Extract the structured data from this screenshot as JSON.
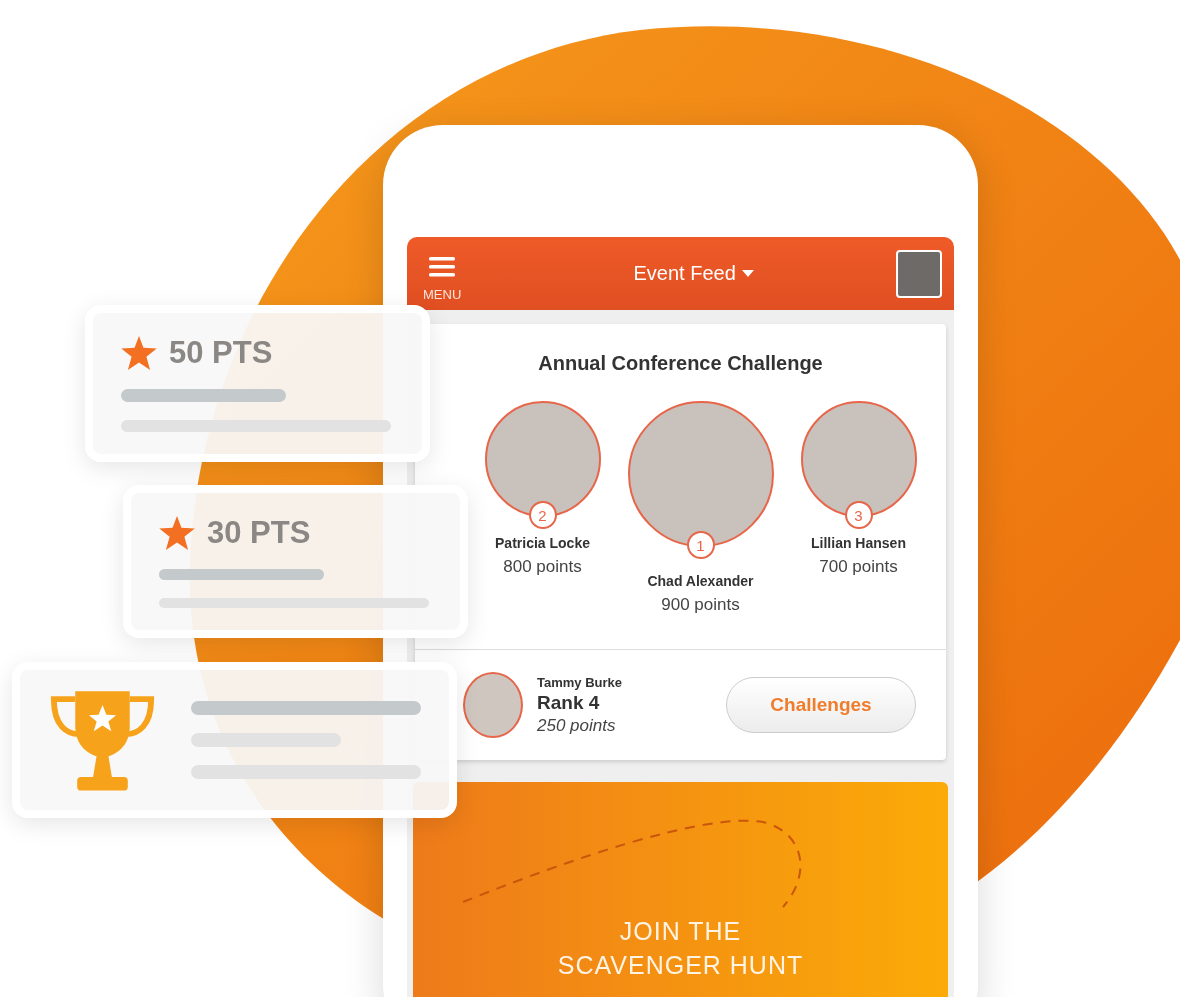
{
  "header": {
    "menu_label": "MENU",
    "title": "Event Feed"
  },
  "leaderboard": {
    "title": "Annual Conference Challenge",
    "leaders": [
      {
        "rank": "2",
        "name": "Patricia Locke",
        "points": "800 points"
      },
      {
        "rank": "1",
        "name": "Chad Alexander",
        "points": "900 points"
      },
      {
        "rank": "3",
        "name": "Lillian Hansen",
        "points": "700 points"
      }
    ]
  },
  "current_user": {
    "name": "Tammy Burke",
    "rank": "Rank 4",
    "points": "250 points"
  },
  "challenges_button": "Challenges",
  "banner": {
    "lines": [
      "JOIN THE",
      "SCAVENGER HUNT"
    ]
  },
  "reward_cards": [
    {
      "kind": "points",
      "label": "50 PTS"
    },
    {
      "kind": "points",
      "label": "30 PTS"
    },
    {
      "kind": "trophy"
    }
  ]
}
